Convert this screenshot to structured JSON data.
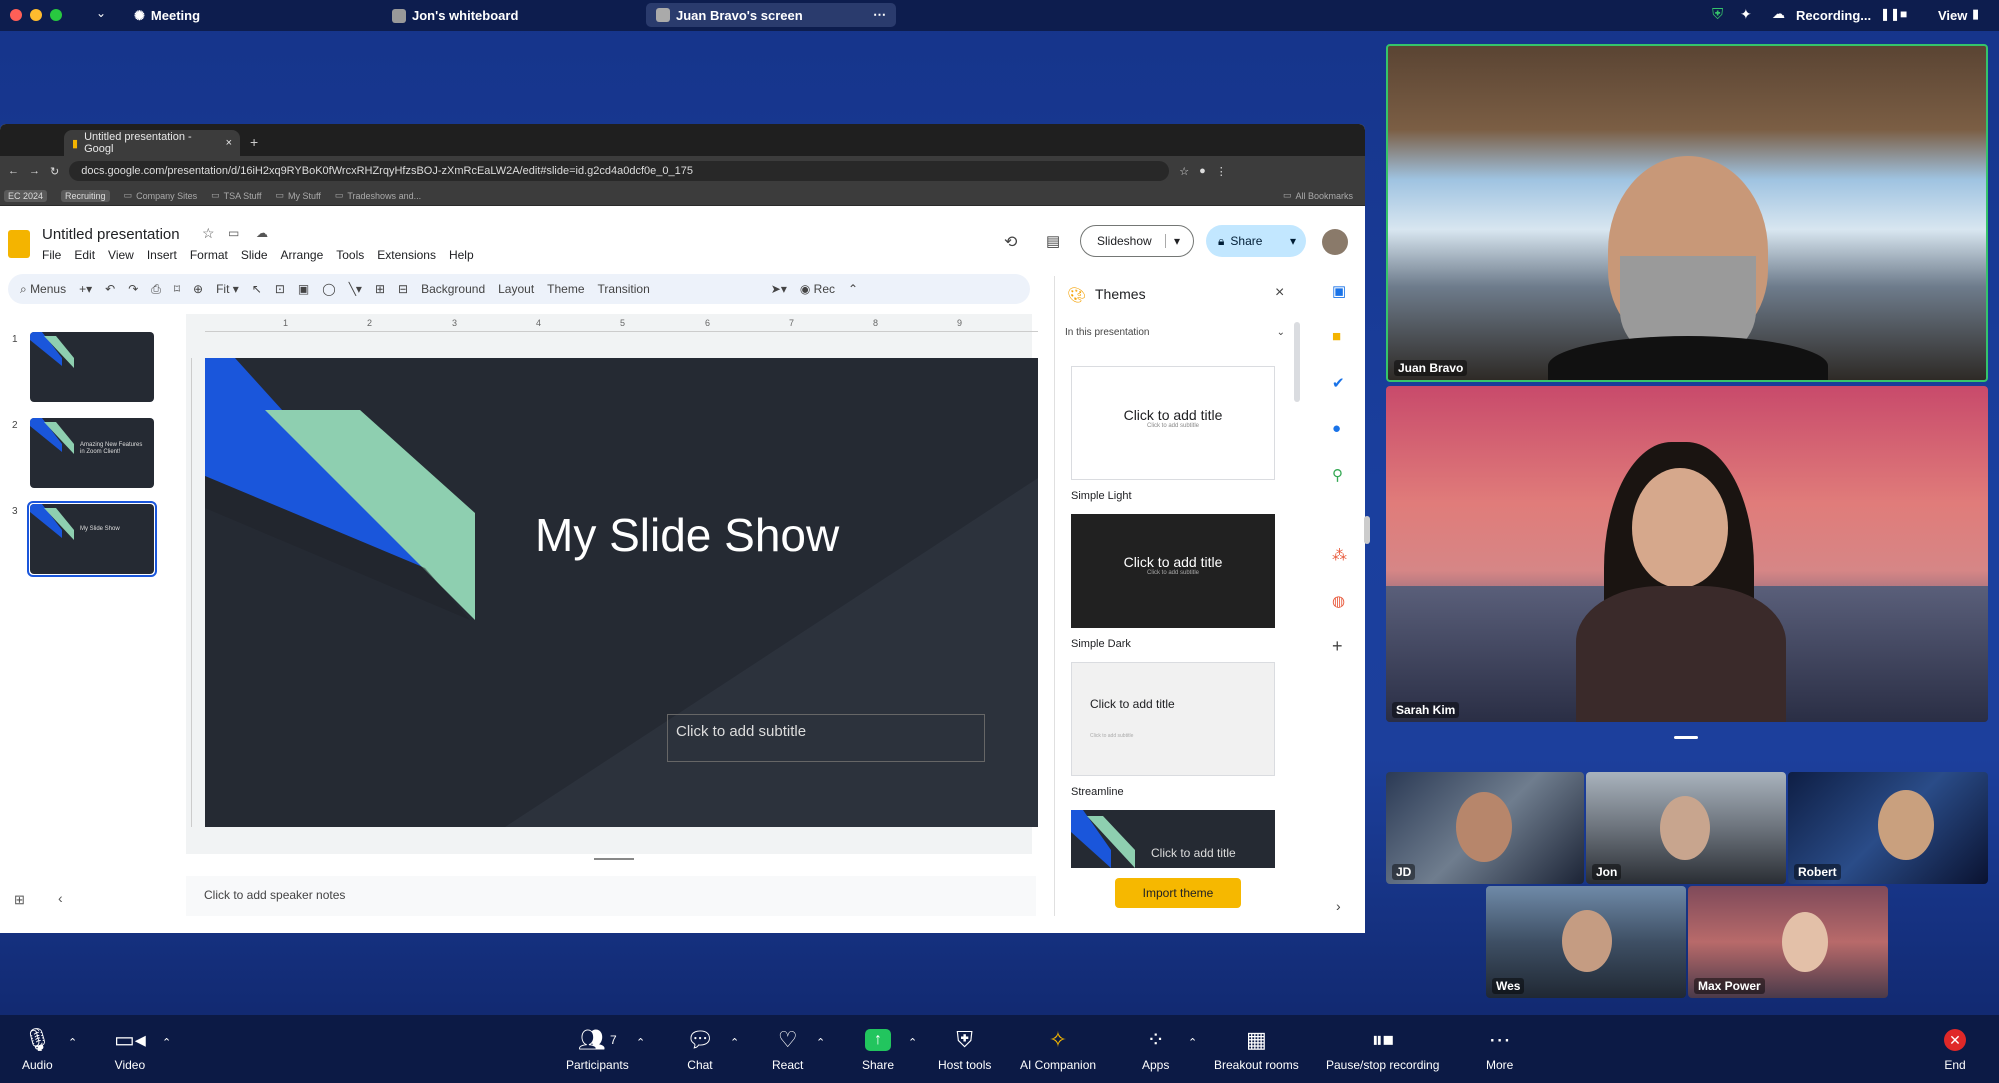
{
  "topbar": {
    "meeting": "Meeting",
    "whiteboard": "Jon's whiteboard",
    "screen_share": "Juan Bravo's screen",
    "recording": "Recording...",
    "view": "View"
  },
  "browser": {
    "tab_title": "Untitled presentation - Googl",
    "url": "docs.google.com/presentation/d/16iH2xq9RYBoK0fWrcxRHZrqyHfzsBOJ-zXmRcEaLW2A/edit#slide=id.g2cd4a0dcf0e_0_175",
    "bookmarks": [
      "EC 2024",
      "Recruiting",
      "Company Sites",
      "TSA Stuff",
      "My Stuff",
      "Tradeshows and..."
    ],
    "all_bookmarks": "All Bookmarks"
  },
  "slides": {
    "doc_title": "Untitled presentation",
    "menu": [
      "File",
      "Edit",
      "View",
      "Insert",
      "Format",
      "Slide",
      "Arrange",
      "Tools",
      "Extensions",
      "Help"
    ],
    "toolbar": {
      "menus": "Menus",
      "zoom": "Fit",
      "background": "Background",
      "layout": "Layout",
      "theme": "Theme",
      "transition": "Transition",
      "rec": "Rec"
    },
    "slideshow": "Slideshow",
    "share": "Share",
    "thumbs": [
      {
        "num": "1",
        "text": ""
      },
      {
        "num": "2",
        "text": "Amazing New Features in Zoom Client!"
      },
      {
        "num": "3",
        "text": "My Slide Show"
      }
    ],
    "ruler": [
      "1",
      "2",
      "3",
      "4",
      "5",
      "6",
      "7",
      "8",
      "9"
    ],
    "slide_title": "My Slide Show",
    "slide_subtitle": "Click to add subtitle",
    "speaker_notes": "Click to add speaker notes",
    "themes": {
      "title": "Themes",
      "filter": "In this presentation",
      "card_title": "Click to add title",
      "card_subtitle": "Click to add subtitle",
      "items": [
        "Simple Light",
        "Simple Dark",
        "Streamline"
      ],
      "import": "Import theme"
    }
  },
  "participants": {
    "main": [
      {
        "name": "Juan Bravo"
      },
      {
        "name": "Sarah Kim"
      }
    ],
    "small": [
      "JD",
      "Jon",
      "Robert",
      "Wes",
      "Max Power"
    ],
    "participant_count": "7"
  },
  "bottom": {
    "audio": "Audio",
    "video": "Video",
    "participants": "Participants",
    "chat": "Chat",
    "react": "React",
    "share": "Share",
    "host_tools": "Host tools",
    "ai": "AI Companion",
    "apps": "Apps",
    "breakout": "Breakout rooms",
    "pause_rec": "Pause/stop recording",
    "more": "More",
    "end": "End"
  },
  "colors": {
    "accent_blue": "#1a56db",
    "accent_green": "#8ecfb0",
    "slide_bg": "#252a33",
    "import_btn": "#f6b800"
  }
}
